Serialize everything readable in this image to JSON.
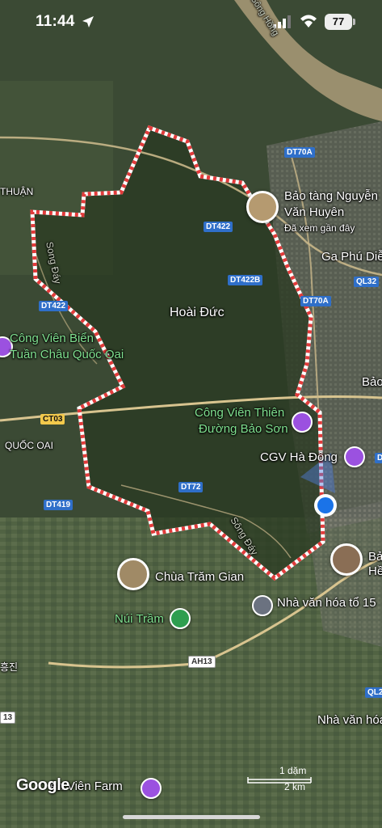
{
  "status_bar": {
    "time": "11:44",
    "battery": "77"
  },
  "places": {
    "hoai_duc": "Hoài Đức",
    "bao_tang_line1": "Bảo tàng Nguyễn",
    "bao_tang_line2": "Văn Huyên",
    "bao_tang_sub": "Đã xem gần đây",
    "ga_phu_dien": "Ga Phú Diễ",
    "thuan": "THUẬN",
    "cong_vien_bien_1": "Công Viên Biển",
    "cong_vien_bien_2": "Tuần Châu Quốc Oai",
    "bao_edge": "Bảo",
    "quoc_oai": "QUỐC OAI",
    "cong_vien_thien_1": "Công Viên Thiên",
    "cong_vien_thien_2": "Đường Bảo Sơn",
    "cgv": "CGV Hà Đông",
    "chua_tram_gian": "Chùa Trăm Gian",
    "nui_tram": "Núi Trầm",
    "nha_van_hoa_15": "Nhà văn hóa tổ 15",
    "nha_van_hoa": "Nhà văn hóa",
    "bao_he_1": "Bả",
    "bao_he_2": "Hề",
    "farm": "ên Viên Farm",
    "song_day": "Song Đáy",
    "song_day_2": "Sông Đáy",
    "song_hong": "Sông Hồng",
    "edge_kr": "흥진"
  },
  "roads": {
    "dt70a_top": "DT70A",
    "dt422_a": "DT422",
    "dt422b": "DT422B",
    "dt70a_mid": "DT70A",
    "ql32": "QL32",
    "dt422_left": "DT422",
    "ct03": "CT03",
    "dt72": "DT72",
    "dt419": "DT419",
    "ah13": "AH13",
    "ql2": "QL2",
    "edge_13": "13",
    "edge_d": "D"
  },
  "attribution": "Google",
  "scale": {
    "imperial": "1 dặm",
    "metric": "2 km"
  },
  "colors": {
    "boundary_red": "#e23b3b",
    "road_blue": "#2f6fc9",
    "expressway_yellow": "#f2c94c",
    "location_blue": "#1a73e8",
    "poi_purple": "#9b51e0",
    "poi_green": "#2e9e4f"
  }
}
